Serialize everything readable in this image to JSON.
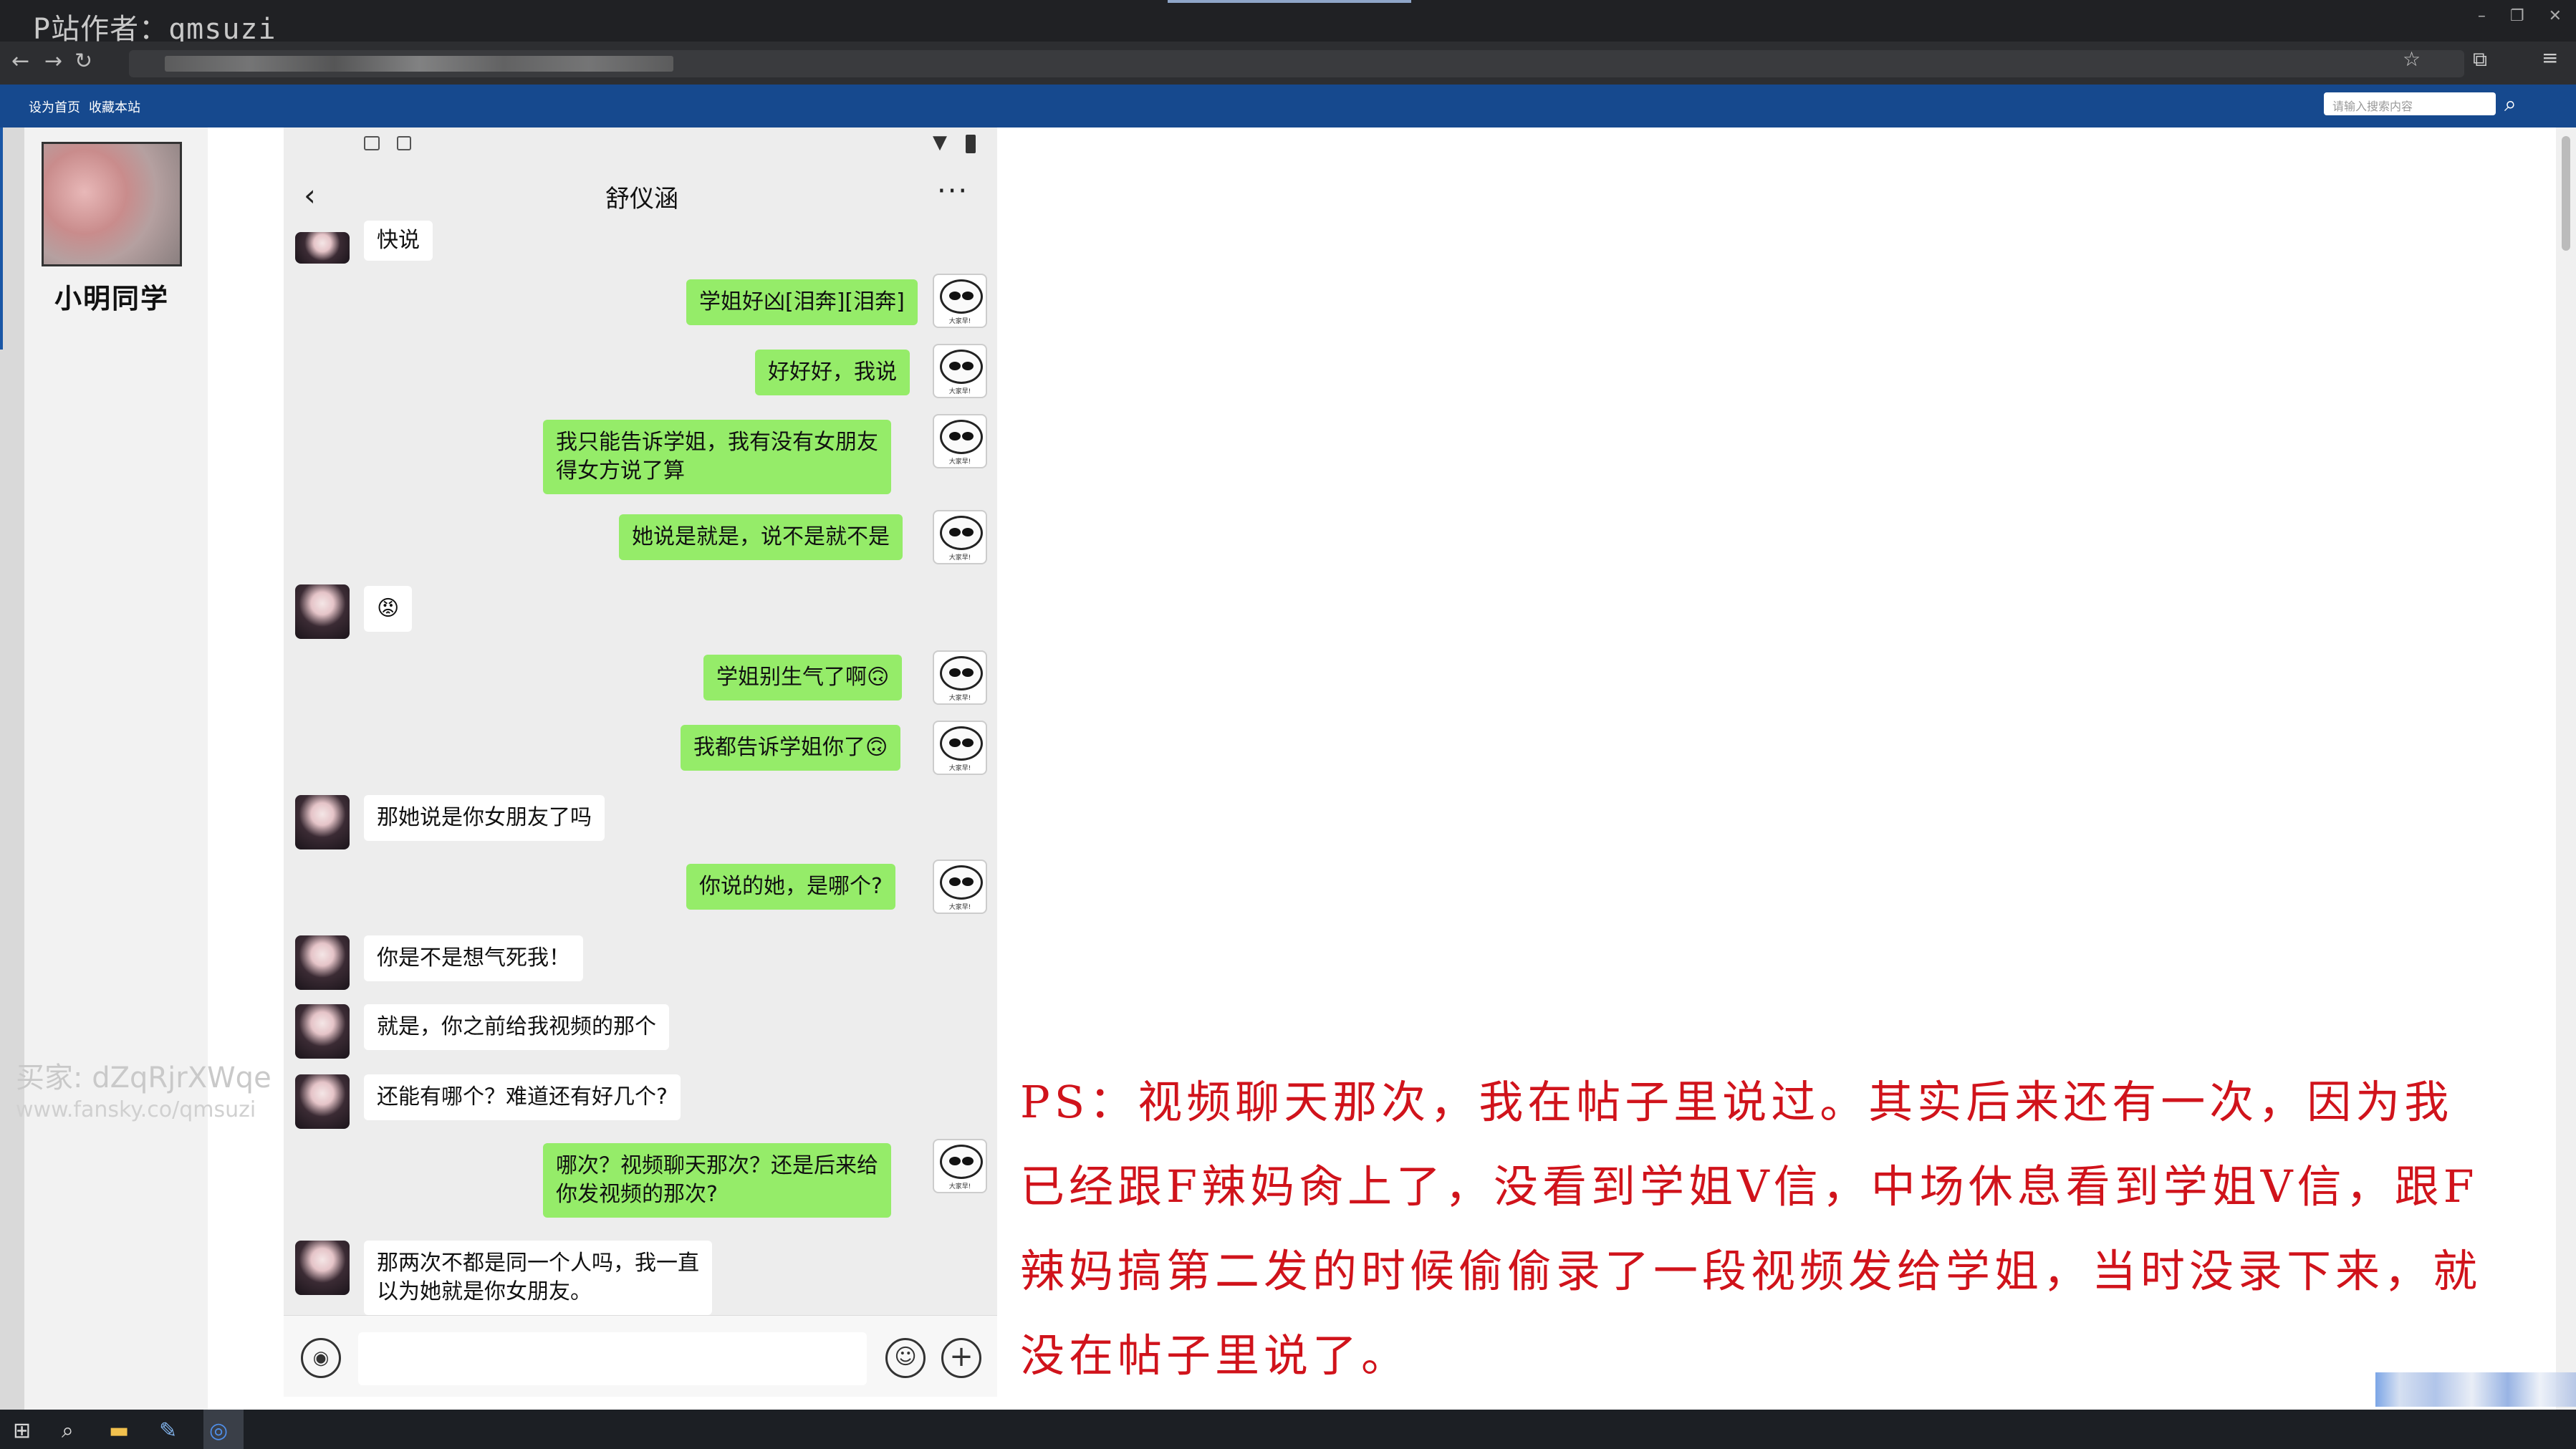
{
  "browser": {
    "watermark": "P站作者：qmsuzi",
    "window_controls": [
      "–",
      "❐",
      "✕"
    ],
    "nav": {
      "back": "←",
      "forward": "→",
      "reload": "↻"
    }
  },
  "site_header": {
    "links": [
      "设为首页",
      "收藏本站"
    ],
    "search_placeholder": "请输入搜索内容"
  },
  "sidebar": {
    "username": "小明同学"
  },
  "watermark": {
    "buyer": "买家: dZqRjrXWqe",
    "site": "www.fansky.co/qmsuzi"
  },
  "chat": {
    "title": "舒仪涵",
    "messages": [
      {
        "side": "in",
        "text": "快说"
      },
      {
        "side": "out",
        "text": "学姐好凶[泪奔][泪奔]"
      },
      {
        "side": "out",
        "text": "好好好，我说"
      },
      {
        "side": "out",
        "text": "我只能告诉学姐，我有没有女朋友\n得女方说了算"
      },
      {
        "side": "out",
        "text": "她说是就是，说不是就不是"
      },
      {
        "side": "in",
        "text": "😡"
      },
      {
        "side": "out",
        "text": "学姐别生气了啊🙃"
      },
      {
        "side": "out",
        "text": "我都告诉学姐你了🙃"
      },
      {
        "side": "in",
        "text": "那她说是你女朋友了吗"
      },
      {
        "side": "out",
        "text": "你说的她，是哪个?"
      },
      {
        "side": "in",
        "text": "你是不是想气死我！"
      },
      {
        "side": "in",
        "text": "就是，你之前给我视频的那个"
      },
      {
        "side": "in",
        "text": "还能有哪个？难道还有好几个?"
      },
      {
        "side": "out",
        "text": "哪次？视频聊天那次？还是后来给\n你发视频的那次?"
      },
      {
        "side": "in",
        "text": "那两次不都是同一个人吗，我一直\n以为她就是你女朋友。"
      }
    ],
    "avatar_caption": "大家早!",
    "icons": {
      "back": "back-icon",
      "more": "more-icon",
      "voice": "voice-icon",
      "emoji": "emoji-icon",
      "plus": "plus-icon"
    }
  },
  "caption": "PS：视频聊天那次，我在帖子里说过。其实后来还有一次，因为我已经跟F辣妈肏上了，没看到学姐V信，中场休息看到学姐V信，跟F辣妈搞第二发的时候偷偷录了一段视频发给学姐，当时没录下来，就没在帖子里说了。",
  "colors": {
    "site_header": "#16498e",
    "outgoing_bubble": "#95ec69",
    "caption": "#d0131b"
  }
}
